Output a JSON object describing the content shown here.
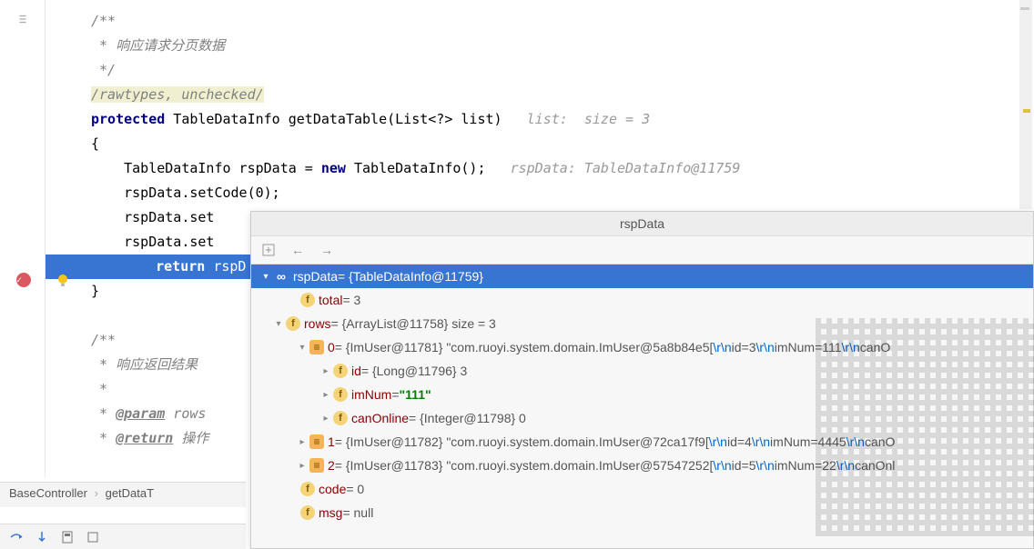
{
  "code": {
    "l1": "/**",
    "l2": " * 响应请求分页数据",
    "l3": " */",
    "l4_a": "/rawtypes, unchecked/",
    "l5_kw": "protected",
    "l5_rest": " TableDataInfo getDataTable(List<?> list)",
    "l5_hint": "   list:  size = 3",
    "l6": "{",
    "l7_a": "    TableDataInfo rspData = ",
    "l7_kw": "new",
    "l7_b": " TableDataInfo();",
    "l7_hint": "   rspData: TableDataInfo@11759",
    "l8": "    rspData.setCode(0);",
    "l9": "    rspData.set",
    "l10": "    rspData.set",
    "l11_kw": "return",
    "l11_b": " rspD",
    "l12": "}",
    "l13": "",
    "l14": "/**",
    "l15": " * 响应返回结果",
    "l16": " *",
    "l17_a": " * ",
    "l17_tag": "@param",
    "l17_b": " rows ",
    "l18_a": " * ",
    "l18_tag": "@return",
    "l18_b": " 操作"
  },
  "breadcrumbs": {
    "a": "BaseController",
    "b": "getDataT"
  },
  "popup": {
    "title": "rspData",
    "root_label": "rspData",
    "root_val": " = {TableDataInfo@11759}",
    "total_label": "total",
    "total_val": " = 3",
    "rows_label": "rows",
    "rows_val": " = {ArrayList@11758}  size = 3",
    "i0_label": "0",
    "i0_val_a": " = {ImUser@11781} \"com.ruoyi.system.domain.ImUser@5a8b84e5[",
    "i0_val_b": " id=3",
    "i0_val_c": " imNum=111",
    "i0_val_d": " canO",
    "id_label": "id",
    "id_val": " = {Long@11796} 3",
    "imnum_label": "imNum",
    "imnum_val": " = ",
    "imnum_str": "\"111\"",
    "canon_label": "canOnline",
    "canon_val": " = {Integer@11798} 0",
    "i1_label": "1",
    "i1_val_a": " = {ImUser@11782} \"com.ruoyi.system.domain.ImUser@72ca17f9[",
    "i1_val_b": " id=4",
    "i1_val_c": " imNum=4445",
    "i1_val_d": " canO",
    "i2_label": "2",
    "i2_val_a": " = {ImUser@11783} \"com.ruoyi.system.domain.ImUser@57547252[",
    "i2_val_b": " id=5",
    "i2_val_c": " imNum=22",
    "i2_val_d": " canOnl",
    "code_label": "code",
    "code_val": " = 0",
    "msg_label": "msg",
    "msg_val": " = null",
    "esc": "\\r\\n"
  }
}
